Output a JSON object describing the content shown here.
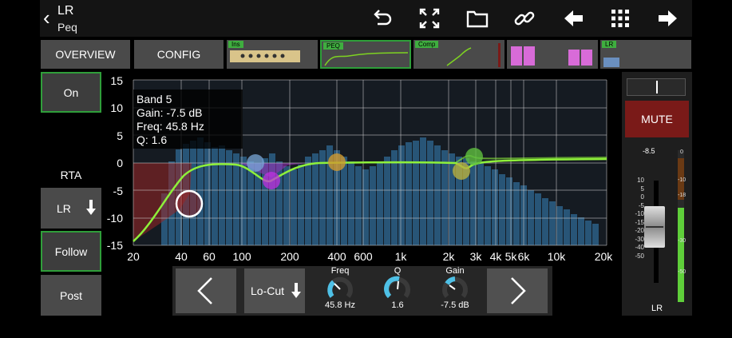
{
  "header": {
    "title": "LR",
    "subtitle": "Peq"
  },
  "toolbar": {
    "icons": [
      "undo-icon",
      "fullscreen-icon",
      "folder-icon",
      "link-icon",
      "arrow-left-icon",
      "grid-icon",
      "arrow-right-icon"
    ]
  },
  "nav": {
    "overview": "OVERVIEW",
    "config": "CONFIG",
    "tabs": [
      "Ins",
      "PEQ",
      "Comp",
      "LR"
    ]
  },
  "left": {
    "on_label": "On",
    "rta_label": "RTA",
    "source_label": "LR",
    "follow_label": "Follow",
    "post_label": "Post"
  },
  "info": {
    "band": "Band 5",
    "gain": "Gain: -7.5 dB",
    "freq": "Freq: 45.8 Hz",
    "q": "Q: 1.6"
  },
  "graph": {
    "y_ticks": [
      "15",
      "10",
      "5",
      "0",
      "-5",
      "-10",
      "-15"
    ],
    "x_ticks": [
      "20",
      "40",
      "60",
      "100",
      "200",
      "400",
      "600",
      "1k",
      "2k",
      "3k",
      "4k",
      "5k",
      "6k",
      "10k",
      "20k"
    ]
  },
  "bottom": {
    "filter_label": "Lo-Cut",
    "freq_label": "Freq",
    "freq_value": "45.8 Hz",
    "q_label": "Q",
    "q_value": "1.6",
    "gain_label": "Gain",
    "gain_value": "-7.5 dB"
  },
  "strip": {
    "mute_label": "MUTE",
    "level_readout": "-8.5",
    "fader_scale": [
      "10",
      "5",
      "0",
      "-5",
      "-10",
      "-15",
      "-20",
      "-30",
      "-40",
      "-50"
    ],
    "meter_scale": [
      "0",
      "-10",
      "-18",
      "-30",
      "-50"
    ],
    "channel_label": "LR"
  },
  "colors": {
    "accent_green": "#2f9e3a",
    "curve_green": "#7ed321",
    "mute_red": "#7a1a18",
    "rta_blue": "#2b5f86"
  }
}
